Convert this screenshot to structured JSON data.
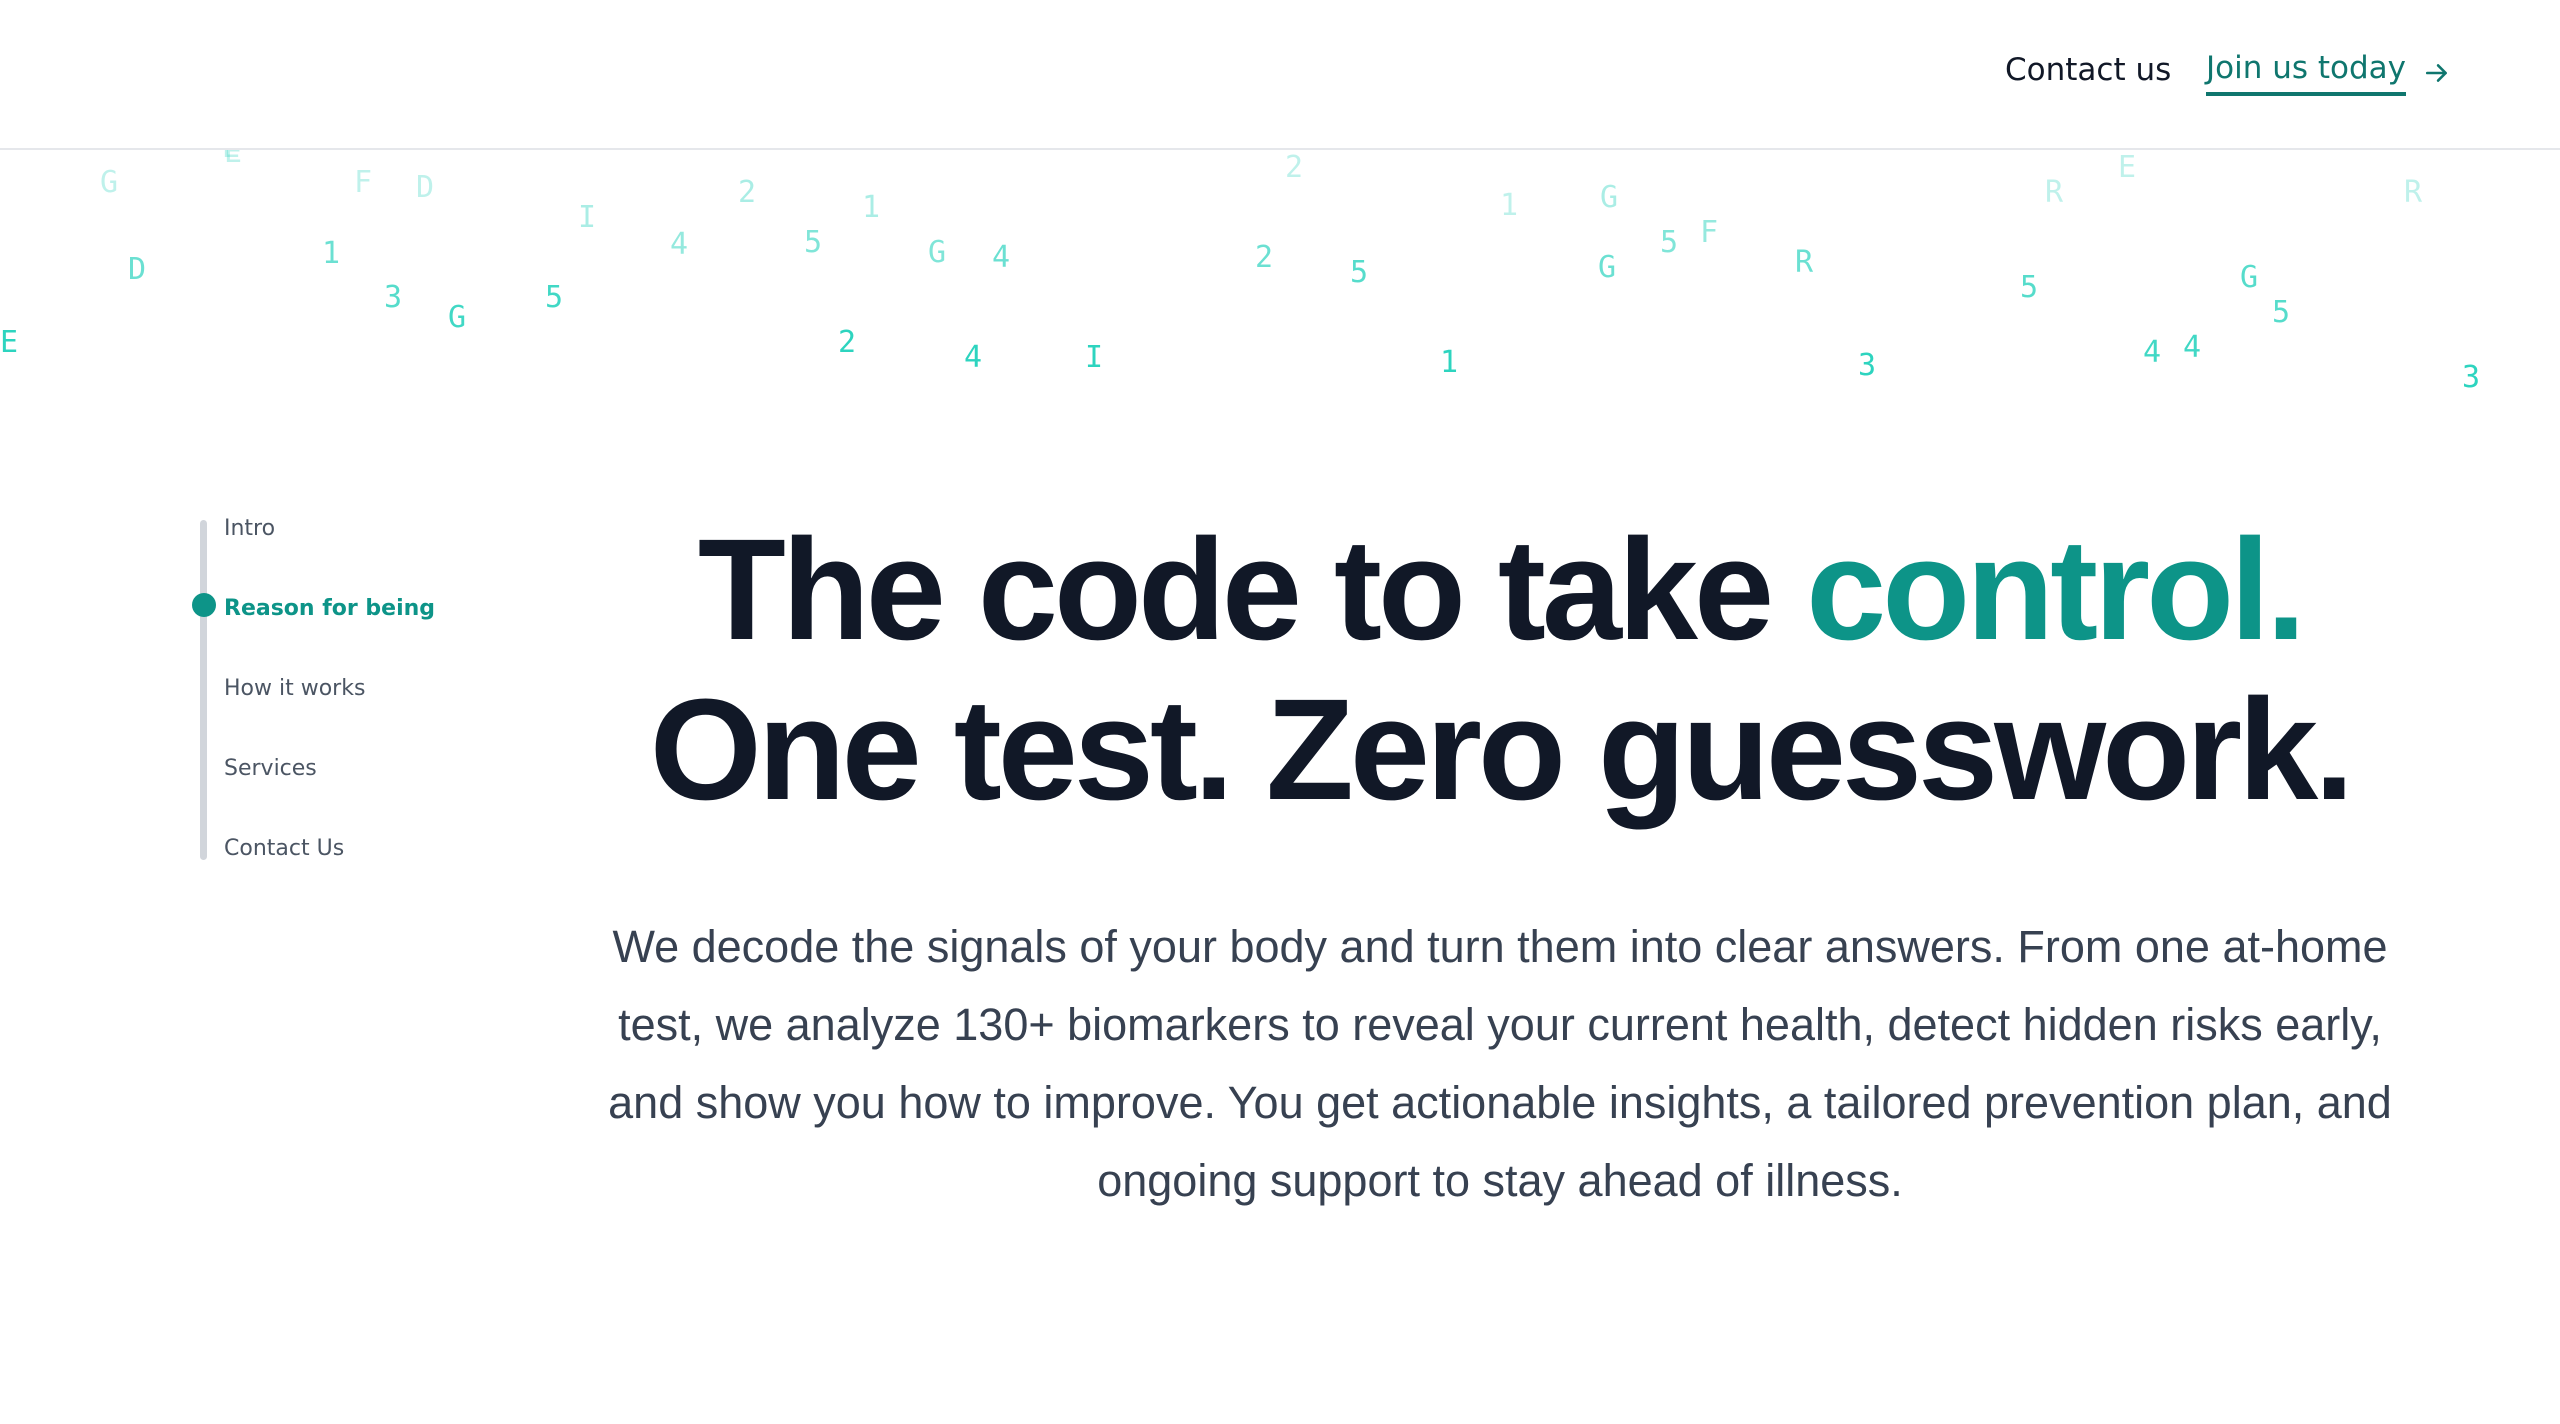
{
  "header": {
    "contact_label": "Contact us",
    "join_label": "Join us today",
    "join_icon": "arrow-right-icon"
  },
  "side_nav": {
    "items": [
      {
        "label": "Intro"
      },
      {
        "label": "Reason for being",
        "active": true
      },
      {
        "label": "How it works"
      },
      {
        "label": "Services"
      },
      {
        "label": "Contact Us"
      }
    ]
  },
  "hero": {
    "title_part1": "The code to take ",
    "title_accent": "control.",
    "title_line2": "One test. Zero guesswork.",
    "body": "We decode the signals of your body and turn them into clear answers. From one at-home test, we analyze 130+ biomarkers to reveal your current health, detect hidden risks early, and show you how to improve. You get actionable insights, a tailored prevention plan, and ongoing support to stay ahead of illness."
  },
  "background_glyphs": [
    "G",
    "E",
    "F",
    "D",
    "D",
    "1",
    "3",
    "G",
    "5",
    "I",
    "4",
    "2",
    "5",
    "1",
    "G",
    "4",
    "2",
    "5",
    "2",
    "1",
    "G",
    "5",
    "G",
    "F",
    "R",
    "R",
    "E",
    "5",
    "G",
    "5",
    "4",
    "4",
    "R",
    "2",
    "4",
    "1",
    "3",
    "E",
    "3",
    "E",
    "I"
  ],
  "colors": {
    "accent": "#0d9488",
    "link": "#0f766e",
    "heading": "#111827",
    "body_text": "#374151",
    "glyph": "#2dd4bf"
  }
}
